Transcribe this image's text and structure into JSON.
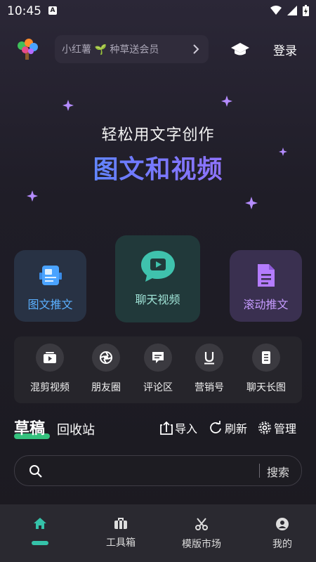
{
  "status_bar": {
    "time": "10:45",
    "badge": "A"
  },
  "header": {
    "promo_text": "小红薯 🌱 种草送会员",
    "login_label": "登录"
  },
  "hero": {
    "subtitle": "轻松用文字创作",
    "title": "图文和视频"
  },
  "cards": [
    {
      "label": "图文推文",
      "icon": "image-text-icon"
    },
    {
      "label": "聊天视频",
      "icon": "chat-video-icon"
    },
    {
      "label": "滚动推文",
      "icon": "scroll-doc-icon"
    }
  ],
  "tools": [
    {
      "label": "混剪视频",
      "icon": "video-mix-icon"
    },
    {
      "label": "朋友圈",
      "icon": "camera-shutter-icon"
    },
    {
      "label": "评论区",
      "icon": "comment-icon"
    },
    {
      "label": "营销号",
      "icon": "underline-u-icon"
    },
    {
      "label": "聊天长图",
      "icon": "long-image-icon"
    }
  ],
  "drafts": {
    "tab_active": "草稿",
    "tab_recycle": "回收站",
    "import_label": "导入",
    "refresh_label": "刷新",
    "manage_label": "管理"
  },
  "search": {
    "placeholder": "",
    "button_label": "搜索"
  },
  "bottom_nav": [
    {
      "label": "",
      "icon": "home-icon",
      "active": true
    },
    {
      "label": "工具箱",
      "icon": "toolbox-icon"
    },
    {
      "label": "模版市场",
      "icon": "scissors-icon"
    },
    {
      "label": "我的",
      "icon": "user-icon"
    }
  ],
  "colors": {
    "accent_green": "#35c27e",
    "title_gradient_start": "#3fa5ff",
    "title_gradient_end": "#b06bff",
    "star_purple": "#b58cff"
  }
}
